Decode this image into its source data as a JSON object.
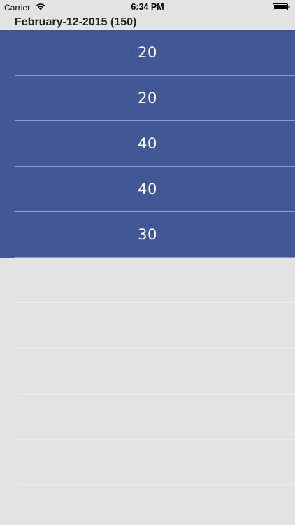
{
  "status_bar": {
    "carrier": "Carrier",
    "time": "6:34 PM",
    "wifi_icon": "wifi-icon",
    "battery_icon": "battery-icon"
  },
  "section": {
    "title": "February-12-2015 (150)"
  },
  "rows": [
    {
      "value": "20"
    },
    {
      "value": "20"
    },
    {
      "value": "40"
    },
    {
      "value": "40"
    },
    {
      "value": "30"
    }
  ],
  "colors": {
    "row_background": "#425796",
    "separator": "#8a9bc8",
    "page_background": "#e3e3e3"
  }
}
